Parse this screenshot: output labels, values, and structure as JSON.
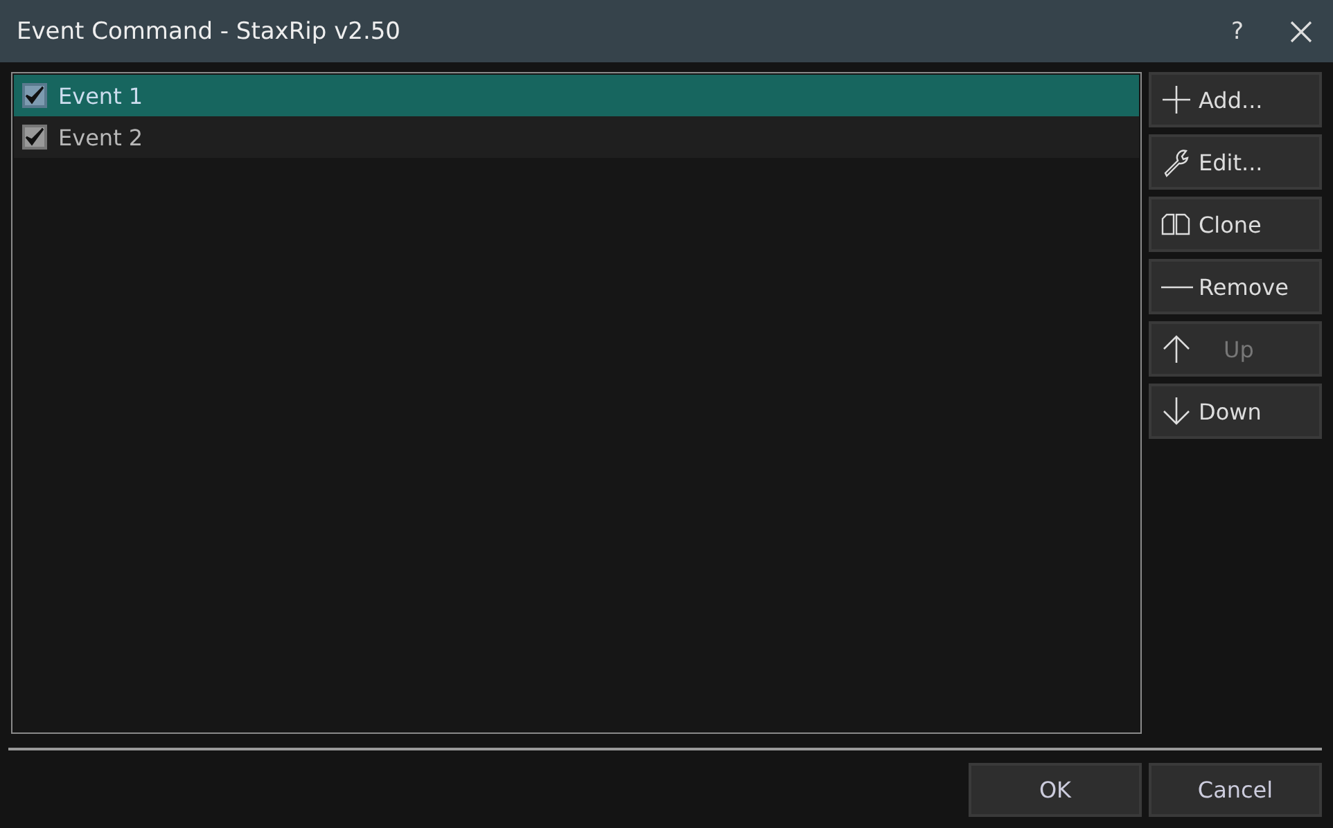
{
  "window": {
    "title": "Event Command - StaxRip v2.50",
    "help": "?"
  },
  "events": [
    {
      "label": "Event 1",
      "checked": true,
      "selected": true
    },
    {
      "label": "Event 2",
      "checked": true,
      "selected": false
    }
  ],
  "side_buttons": [
    {
      "kind": "add",
      "label": "Add...",
      "disabled": false
    },
    {
      "kind": "edit",
      "label": "Edit...",
      "disabled": false
    },
    {
      "kind": "clone",
      "label": "Clone",
      "disabled": false
    },
    {
      "kind": "remove",
      "label": "Remove",
      "disabled": false
    },
    {
      "kind": "up",
      "label": "Up",
      "disabled": true
    },
    {
      "kind": "down",
      "label": "Down",
      "disabled": false
    }
  ],
  "buttons": [
    "OK",
    "Cancel"
  ]
}
